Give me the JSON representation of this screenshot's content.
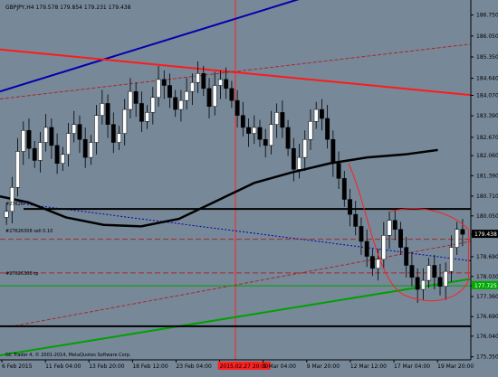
{
  "window": {
    "symbol_line": "GBPJPY,H4  179.578 179.854 179.231 179.438",
    "copyright": "GC Trader 4, © 2001-2014, MetaQuotes Software Corp."
  },
  "colors": {
    "background": "#778899",
    "bull_candle": "#000000",
    "bear_candle": "#ffffff",
    "blue_trend": "#0000aa",
    "red_trend": "#ff1a1a",
    "dashed_red": "#a52a2a",
    "green_trend": "#00a000",
    "black_line": "#000000",
    "ma": "#000000",
    "envelope": "#ff2020",
    "vline": "#ff2020",
    "price_tag": "#000000",
    "green_tag": "#00aa00"
  },
  "annotations": {
    "sell_label": "#27626308 sell 0.10",
    "tp_label": "#27626308 tp",
    "left_label": "#27626",
    "highlight_time": "2015.02.27 20:00"
  },
  "chart_data": {
    "type": "candlestick",
    "title": "GBPJPY,H4",
    "ohlc_last": {
      "open": 179.578,
      "high": 179.854,
      "low": 179.231,
      "close": 179.438
    },
    "ylim": [
      175.25,
      187.25
    ],
    "y_ticks": [
      "186.750",
      "186.050",
      "185.350",
      "184.640",
      "184.070",
      "183.390",
      "182.670",
      "182.060",
      "181.390",
      "180.710",
      "180.050",
      "179.438",
      "178.690",
      "178.030",
      "177.725",
      "177.360",
      "176.690",
      "176.040",
      "175.350"
    ],
    "x_ticks": [
      "6 Feb 2015",
      "11 Feb 04:00",
      "13 Feb 20:00",
      "18 Feb 12:00",
      "23 Feb 04:00",
      "2015.02.27 20:00",
      "5 Mar 04:00",
      "9 Mar 20:00",
      "12 Mar 12:00",
      "17 Mar 04:00",
      "19 Mar 20:00"
    ],
    "current_price": 179.438,
    "green_level": 177.725,
    "close_series": [
      180.2,
      181.0,
      182.2,
      182.9,
      182.3,
      181.9,
      182.5,
      183.0,
      182.4,
      181.8,
      182.1,
      182.8,
      183.1,
      182.6,
      182.0,
      182.5,
      183.4,
      183.8,
      183.1,
      182.5,
      182.8,
      183.6,
      184.2,
      183.8,
      183.2,
      183.5,
      184.0,
      184.6,
      184.4,
      184.0,
      183.6,
      183.9,
      184.2,
      184.5,
      184.8,
      184.3,
      183.7,
      184.4,
      184.6,
      184.3,
      183.9,
      183.4,
      183.0,
      182.8,
      183.0,
      182.6,
      182.4,
      183.1,
      183.5,
      183.0,
      182.3,
      181.6,
      182.0,
      182.6,
      183.2,
      183.6,
      183.3,
      182.6,
      181.8,
      181.3,
      180.6,
      180.1,
      179.7,
      179.2,
      178.7,
      178.3,
      178.6,
      179.4,
      179.9,
      179.6,
      179.0,
      178.4,
      178.0,
      177.6,
      177.9,
      178.4,
      178.0,
      177.7,
      178.2,
      179.0,
      179.6,
      179.438
    ],
    "lines": [
      {
        "name": "blue-trendline",
        "x": [
          0,
          0.66
        ],
        "y": [
          184.2,
          187.4
        ]
      },
      {
        "name": "red-trendline",
        "x": [
          0,
          1
        ],
        "y": [
          185.6,
          184.08
        ]
      },
      {
        "name": "green-trendline",
        "x": [
          0,
          1
        ],
        "y": [
          175.4,
          177.95
        ]
      },
      {
        "name": "upper-dashed-channel",
        "x": [
          0,
          1
        ],
        "y": [
          183.95,
          185.78
        ]
      },
      {
        "name": "lower-dashed-channel",
        "x": [
          0.02,
          1
        ],
        "y": [
          176.35,
          179.2
        ]
      },
      {
        "name": "sell-dashed-line",
        "x": [
          0.05,
          1
        ],
        "y": [
          180.45,
          178.55
        ]
      },
      {
        "name": "black-upper-horizontal",
        "x": [
          0.05,
          1
        ],
        "y": [
          180.28,
          180.28
        ]
      },
      {
        "name": "black-lower-horizontal",
        "x": [
          0,
          1
        ],
        "y": [
          176.37,
          176.37
        ]
      },
      {
        "name": "sell-level",
        "x": [
          0,
          1
        ],
        "y": [
          179.27,
          179.27
        ]
      },
      {
        "name": "tp-level",
        "x": [
          0,
          1
        ],
        "y": [
          178.15,
          178.15
        ]
      },
      {
        "name": "green-horizontal",
        "x": [
          0,
          1
        ],
        "y": [
          177.72,
          177.72
        ]
      }
    ],
    "moving_average": {
      "x": [
        0,
        0.06,
        0.14,
        0.22,
        0.3,
        0.38,
        0.46,
        0.54,
        0.62,
        0.7,
        0.78,
        0.86,
        0.93
      ],
      "y": [
        180.7,
        180.5,
        180.0,
        179.75,
        179.7,
        179.95,
        180.55,
        181.15,
        181.5,
        181.8,
        182.0,
        182.1,
        182.25
      ]
    }
  }
}
